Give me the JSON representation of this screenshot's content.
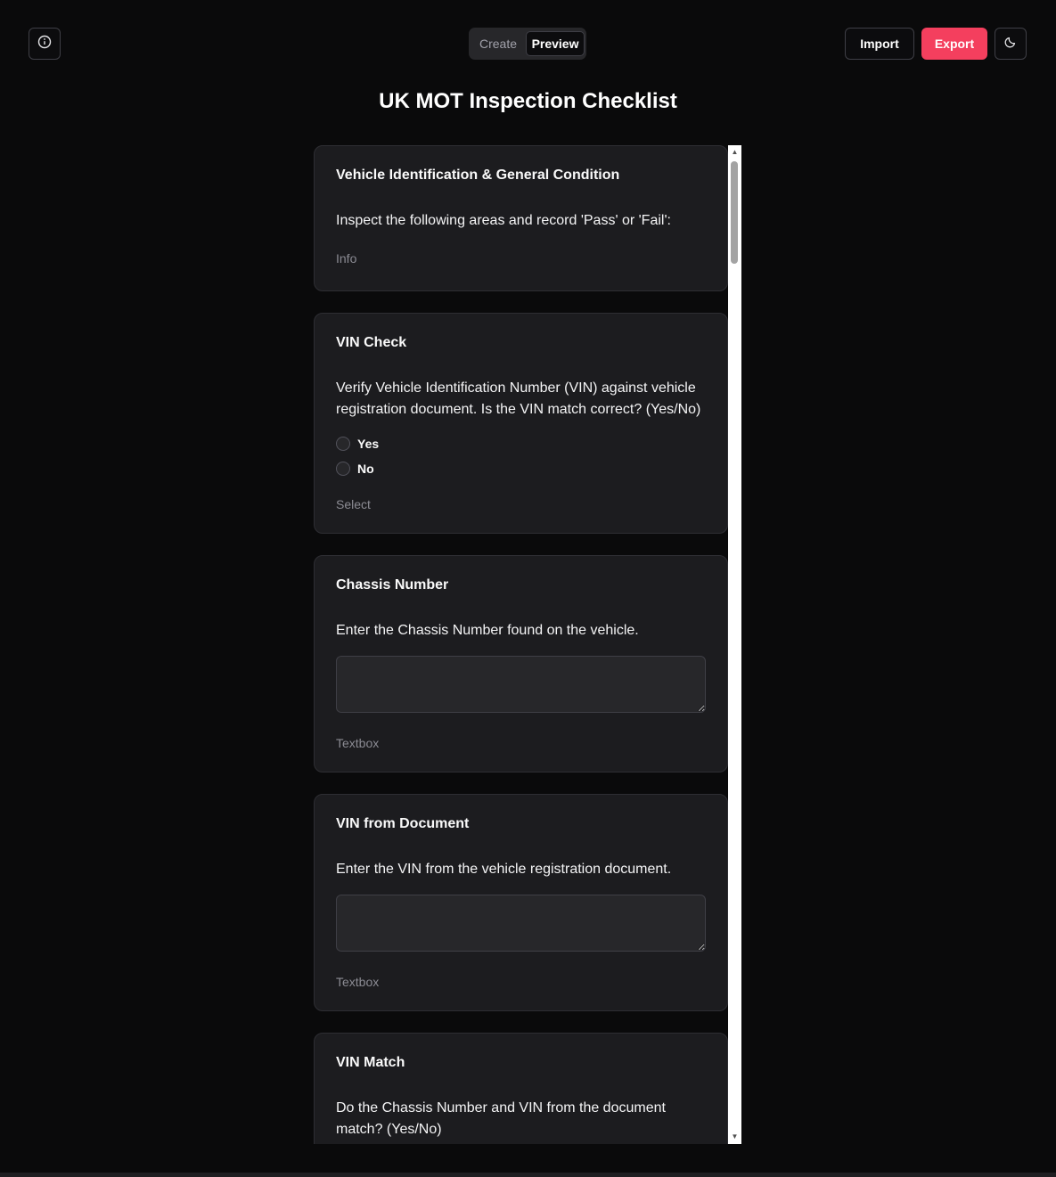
{
  "header": {
    "tabs": [
      {
        "label": "Create",
        "active": false
      },
      {
        "label": "Preview",
        "active": true
      }
    ],
    "import_label": "Import",
    "export_label": "Export",
    "icons": {
      "info": "info-icon",
      "theme": "moon-icon"
    },
    "accent_color": "#f43f5e"
  },
  "page": {
    "title": "UK MOT Inspection Checklist"
  },
  "cards": [
    {
      "title": "Vehicle Identification & General Condition",
      "description": "Inspect the following areas and record 'Pass' or 'Fail':",
      "type": "Info"
    },
    {
      "title": "VIN Check",
      "description": "Verify Vehicle Identification Number (VIN) against vehicle registration document. Is the VIN match correct? (Yes/No)",
      "options": [
        "Yes",
        "No"
      ],
      "type": "Select"
    },
    {
      "title": "Chassis Number",
      "description": "Enter the Chassis Number found on the vehicle.",
      "value": "",
      "type": "Textbox"
    },
    {
      "title": "VIN from Document",
      "description": "Enter the VIN from the vehicle registration document.",
      "value": "",
      "type": "Textbox"
    },
    {
      "title": "VIN Match",
      "description": "Do the Chassis Number and VIN from the document match? (Yes/No)"
    }
  ]
}
